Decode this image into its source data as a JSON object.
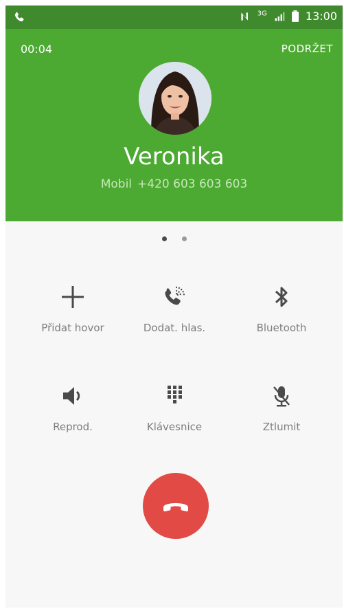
{
  "status_bar": {
    "left_icon": "phone-icon",
    "nfc_icon": "nfc-icon",
    "network_type": "3G",
    "signal_icon": "signal-icon",
    "battery_icon": "battery-icon",
    "time": "13:00"
  },
  "call": {
    "duration": "00:04",
    "hold_label": "PODRŽET",
    "caller_name": "Veronika",
    "number_label": "Mobil",
    "phone_number": "+420 603 603 603",
    "avatar_icon": "avatar-photo"
  },
  "pager": {
    "pages": 2,
    "active": 1
  },
  "actions": [
    {
      "label": "Přidat hovor",
      "icon": "plus-icon"
    },
    {
      "label": "Dodat. hlas.",
      "icon": "phone-volume-icon"
    },
    {
      "label": "Bluetooth",
      "icon": "bluetooth-icon"
    },
    {
      "label": "Reprod.",
      "icon": "speaker-icon"
    },
    {
      "label": "Klávesnice",
      "icon": "keypad-icon"
    },
    {
      "label": "Ztlumit",
      "icon": "mic-off-icon"
    }
  ],
  "end_call": {
    "icon": "end-call-icon",
    "color": "#e24b45"
  },
  "colors": {
    "header": "#4caa32",
    "status_bar": "#3f8a2d",
    "icons": "#4a4a4a"
  }
}
